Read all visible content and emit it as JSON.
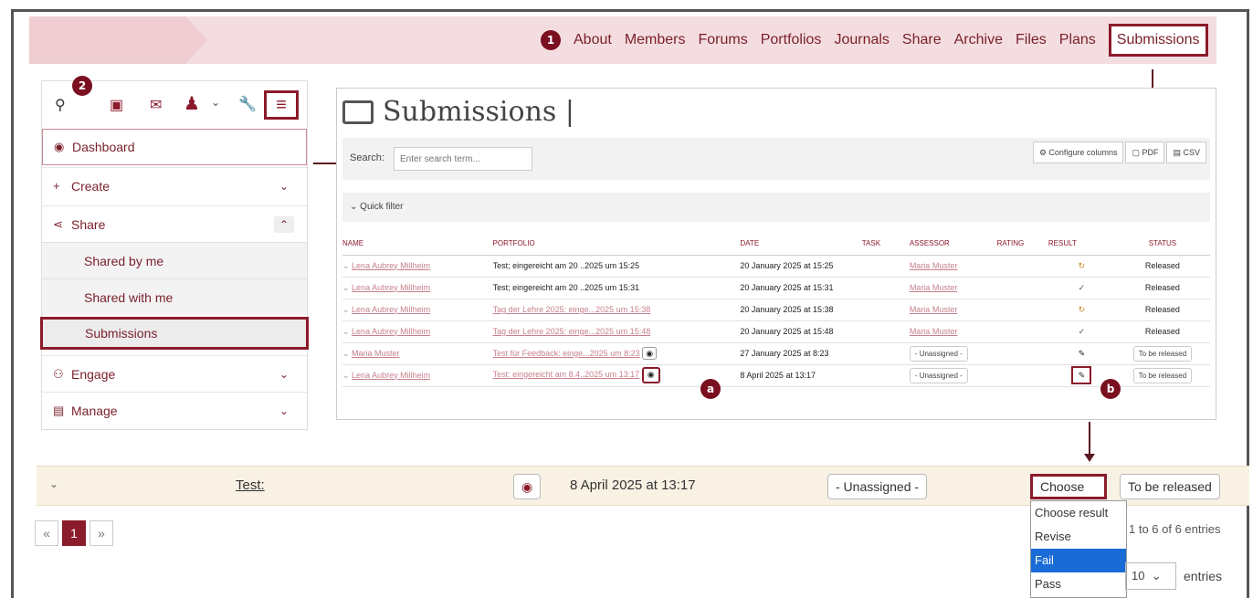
{
  "nav": {
    "badge": "1",
    "links": [
      "About",
      "Members",
      "Forums",
      "Portfolios",
      "Journals",
      "Share",
      "Archive",
      "Files",
      "Plans"
    ],
    "active": "Submissions"
  },
  "sidebar": {
    "badge": "2",
    "items": [
      {
        "label": "Dashboard",
        "icon": "dashboard-icon"
      },
      {
        "label": "Create",
        "icon": "plus-icon"
      },
      {
        "label": "Share",
        "icon": "share-icon"
      },
      {
        "label": "Engage",
        "icon": "people-icon"
      },
      {
        "label": "Manage",
        "icon": "briefcase-icon"
      }
    ],
    "sub": [
      "Shared by me",
      "Shared with me",
      "Submissions"
    ]
  },
  "main": {
    "title": "Submissions |",
    "search_label": "Search:",
    "search_placeholder": "Enter search term...",
    "configure": "Configure columns",
    "pdf": "PDF",
    "csv": "CSV",
    "quick_filter": "Quick filter",
    "headers": [
      "NAME",
      "PORTFOLIO",
      "DATE",
      "TASK",
      "ASSESSOR",
      "RATING",
      "RESULT",
      "STATUS"
    ],
    "rows": [
      {
        "name": "Lena Aubrey Millheim",
        "portfolio": "Test; eingereicht am 20 ..2025 um 15:25",
        "date": "20 January 2025 at 15:25",
        "assessor": "Maria Muster",
        "result": "↻",
        "status": "Released"
      },
      {
        "name": "Lena Aubrey Millheim",
        "portfolio": "Test; eingereicht am 20 ..2025 um 15:31",
        "date": "20 January 2025 at 15:31",
        "assessor": "Maria Muster",
        "result": "✓",
        "status": "Released"
      },
      {
        "name": "Lena Aubrey Millheim",
        "portfolio": "Tag der Lehre 2025: einge...2025 um 15:38",
        "date": "20 January 2025 at 15:38",
        "assessor": "Maria Muster",
        "result": "↻",
        "status": "Released"
      },
      {
        "name": "Lena Aubrey Millheim",
        "portfolio": "Tag der Lehre 2025: einge...2025 um 15:48",
        "date": "20 January 2025 at 15:48",
        "assessor": "Maria Muster",
        "result": "✓",
        "status": "Released"
      },
      {
        "name": "Maria Muster",
        "portfolio": "Test für Feedback: einge...2025 um 8:23",
        "date": "27 January 2025 at 8:23",
        "assessor": "- Unassigned -",
        "result": "✎",
        "status": "To be released"
      },
      {
        "name": "Lena Aubrey Millheim",
        "portfolio": "Test: eingereicht am 8.4..2025 um 13:17",
        "date": "8 April 2025 at 13:17",
        "assessor": "- Unassigned -",
        "result": "✎",
        "status": "To be released"
      }
    ],
    "badge_a": "a",
    "badge_b": "b"
  },
  "zoom": {
    "portfolio": "Test:",
    "date": "8 April 2025 at 13:17",
    "assessor": "- Unassigned -",
    "choose": "Choose",
    "status": "To be released"
  },
  "dropdown": [
    "Choose result",
    "Revise",
    "Fail",
    "Pass"
  ],
  "pager": {
    "prev": "«",
    "page": "1",
    "next": "»"
  },
  "entries": "1 to 6 of 6 entries",
  "perpage": {
    "value": "10",
    "label": "entries"
  },
  "colors": {
    "accent": "#8b1a2b",
    "nav_bg": "#f4dde0",
    "highlight": "#1a6bd6"
  }
}
